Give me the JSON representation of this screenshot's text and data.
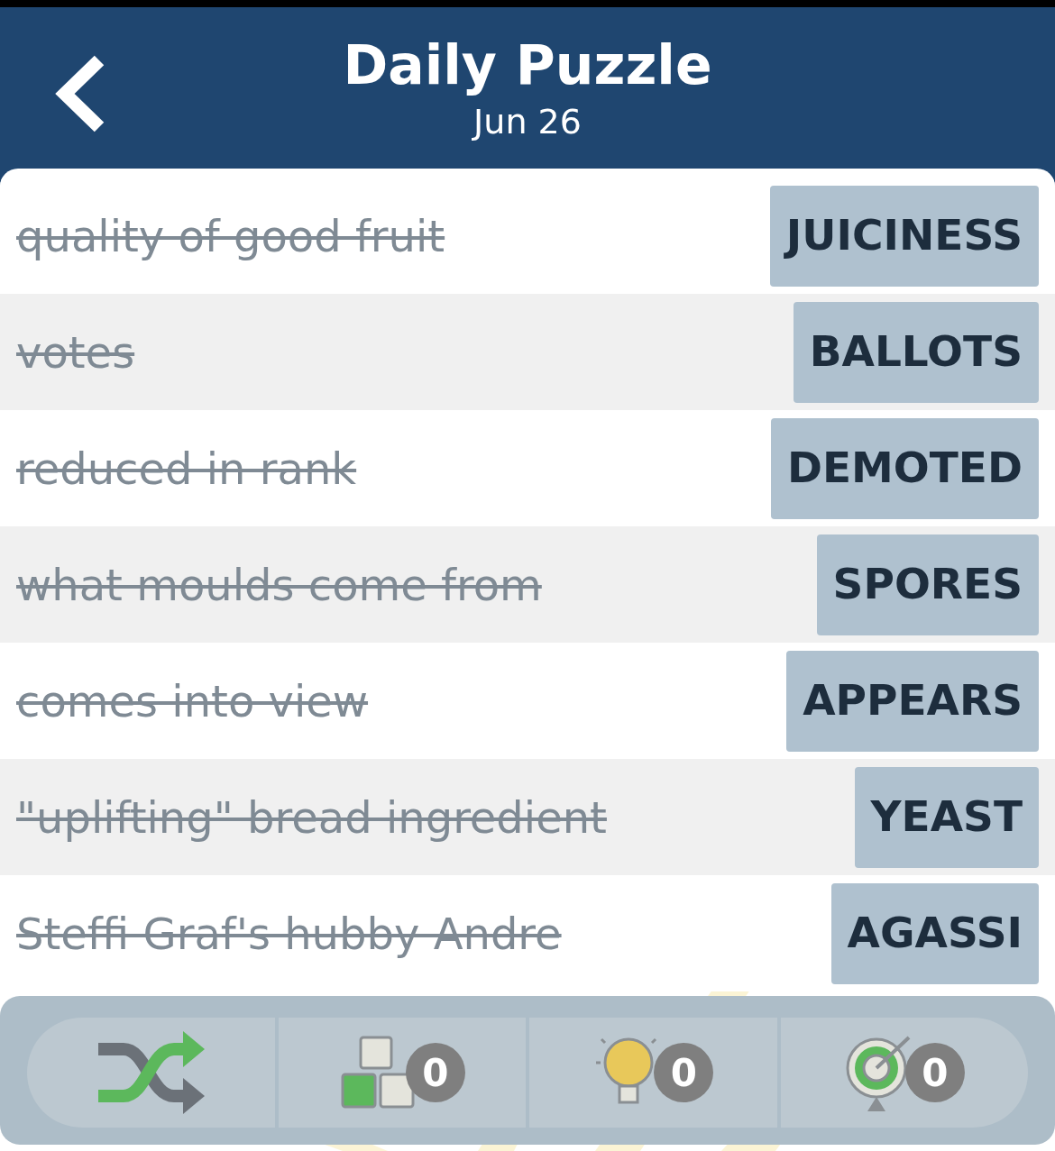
{
  "header": {
    "title": "Daily Puzzle",
    "date": "Jun 26"
  },
  "clues": [
    {
      "clue": "quality of good fruit",
      "answer": "JUICINESS",
      "solved": true
    },
    {
      "clue": "votes",
      "answer": "BALLOTS",
      "solved": true
    },
    {
      "clue": "reduced in rank",
      "answer": "DEMOTED",
      "solved": true
    },
    {
      "clue": "what moulds come from",
      "answer": "SPORES",
      "solved": true
    },
    {
      "clue": "comes into view",
      "answer": "APPEARS",
      "solved": true
    },
    {
      "clue": "\"uplifting\" bread ingredient",
      "answer": "YEAST",
      "solved": true
    },
    {
      "clue": "Steffi Graf's hubby Andre",
      "answer": "AGASSI",
      "solved": true
    }
  ],
  "toolbar": [
    {
      "kind": "shuffle"
    },
    {
      "kind": "letters",
      "count": "0"
    },
    {
      "kind": "hint",
      "count": "0"
    },
    {
      "kind": "target",
      "count": "0"
    }
  ]
}
